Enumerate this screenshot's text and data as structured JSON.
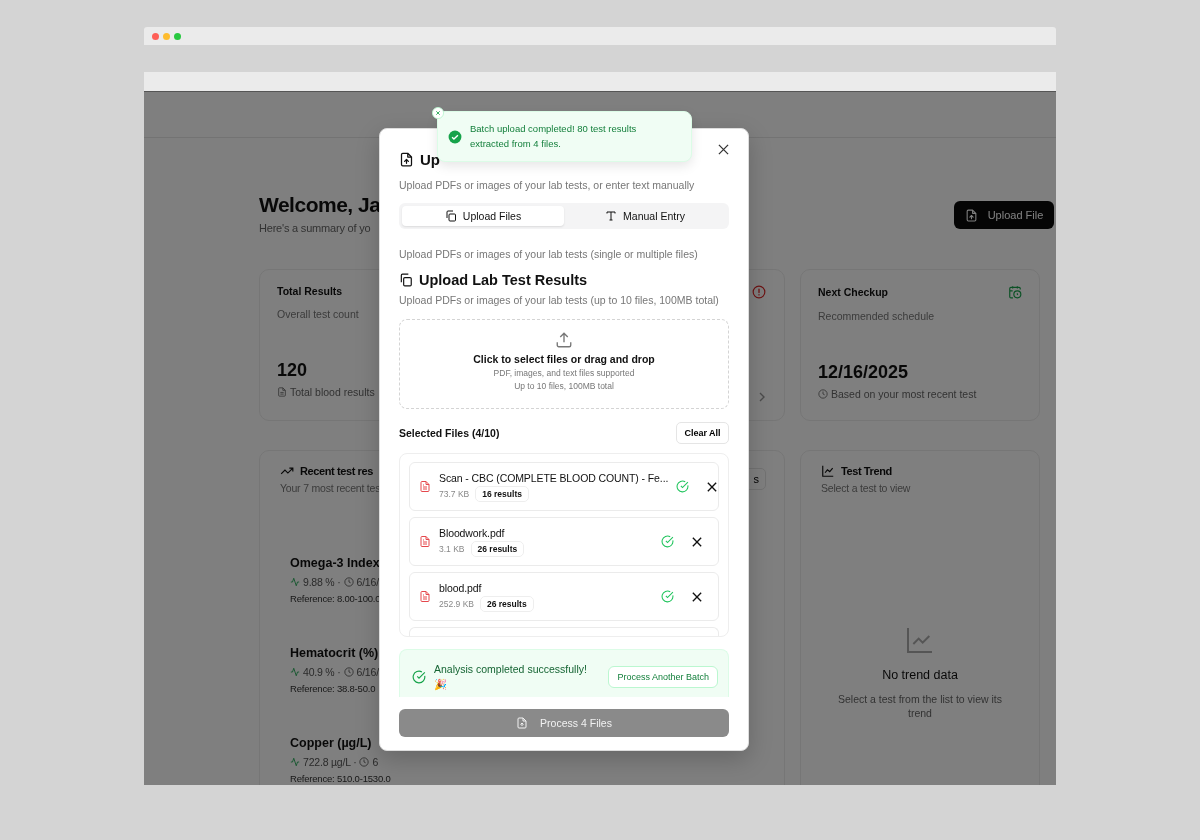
{
  "dashboard": {
    "upload_button": "Upload File",
    "welcome": "Welcome, Ja",
    "summary": "Here's a summary of yo",
    "cards": [
      {
        "title": "Total Results",
        "subtitle": "Overall test count",
        "value": "120",
        "note": "Total blood results"
      },
      {
        "title": "Next Checkup",
        "subtitle": "Recommended schedule",
        "value": "12/16/2025",
        "note": "Based on your most recent test"
      }
    ],
    "recent": {
      "title": "Recent test res",
      "subtitle": "Your 7 most recent tes",
      "button_fragment": "s",
      "items": [
        {
          "name": "Omega-3 Index",
          "value": "9.88 % ·",
          "date": "6/16/",
          "reference": "Reference: 8.00-100.0"
        },
        {
          "name": "Hematocrit (%)",
          "value": "40.9 % ·",
          "date": "6/16/",
          "reference": "Reference: 38.8-50.0"
        },
        {
          "name": "Copper (µg/L)",
          "value": "722.8 µg/L ·",
          "date": "6",
          "reference": "Reference: 510.0-1530.0"
        }
      ]
    },
    "trend": {
      "title": "Test Trend",
      "subtitle": "Select a test to view",
      "empty_title": "No trend data",
      "empty_text": "Select a test from the list to view its trend"
    }
  },
  "modal": {
    "title": "Up",
    "description": "Upload PDFs or images of your lab tests, or enter text manually",
    "tabs": [
      {
        "label": "Upload Files",
        "selected": true
      },
      {
        "label": "Manual Entry",
        "selected": false
      }
    ],
    "tab_description": "Upload PDFs or images of your lab tests (single or multiple files)",
    "heading": "Upload Lab Test Results",
    "heading_note": "Upload PDFs or images of your lab tests (up to 10 files, 100MB total)",
    "dropzone": {
      "title": "Click to select files or drag and drop",
      "line_1": "PDF, images, and text files supported",
      "line_2": "Up to 10 files, 100MB total"
    },
    "selected_label": "Selected Files (4/10)",
    "clear_button": "Clear All",
    "files": [
      {
        "name": "Scan - CBC (COMPLETE BLOOD COUNT) - Fe...",
        "size": "73.7 KB",
        "results": "16 results",
        "processed": true
      },
      {
        "name": "Bloodwork.pdf",
        "size": "3.1 KB",
        "results": "26 results",
        "processed": true
      },
      {
        "name": "blood.pdf",
        "size": "252.9 KB",
        "results": "26 results",
        "processed": true
      }
    ],
    "success": {
      "message": "Analysis completed successfully!",
      "emoji": "🎉",
      "button": "Process Another Batch"
    },
    "process_button": {
      "label": "Process 4 Files",
      "disabled": true
    }
  },
  "toast": {
    "message": "Batch upload completed! 80 test results extracted from 4 files."
  }
}
